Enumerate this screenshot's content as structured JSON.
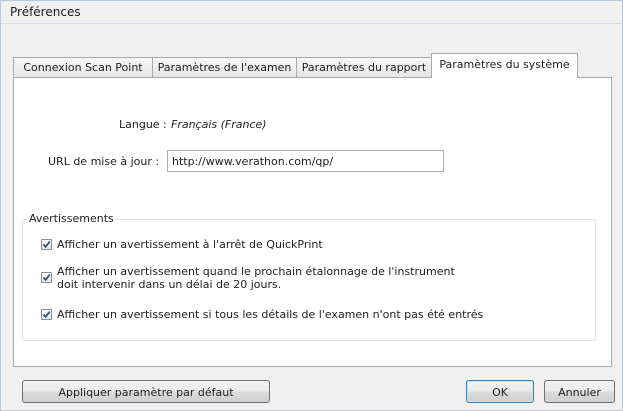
{
  "window": {
    "title": "Préférences"
  },
  "tabs": [
    {
      "label": "Connexion Scan Point"
    },
    {
      "label": "Paramètres de l'examen"
    },
    {
      "label": "Paramètres du rapport"
    },
    {
      "label": "Paramètres du système",
      "active": true
    }
  ],
  "system": {
    "language_label": "Langue :",
    "language_value": "Français (France)",
    "update_url_label": "URL de mise à jour :",
    "update_url_value": "http://www.verathon.com/qp/"
  },
  "warnings": {
    "group_title": "Avertissements",
    "items": [
      {
        "label": "Afficher un avertissement à l'arrêt de QuickPrint",
        "checked": true
      },
      {
        "label_line1": "Afficher un avertissement quand le prochain étalonnage de l'instrument",
        "label_line2": "doit intervenir dans un délai de 20 jours.",
        "checked": true
      },
      {
        "label": "Afficher un avertissement si tous les détails de l'examen n'ont pas été entrés",
        "checked": true
      }
    ]
  },
  "buttons": {
    "apply_default": "Appliquer paramètre par défaut",
    "ok": "OK",
    "cancel": "Annuler"
  },
  "colors": {
    "check": "#2c4e86",
    "window_bg": "#f0f0f0",
    "panel_bg": "#ffffff"
  },
  "icons": {
    "checkbox_check": "check-icon"
  }
}
